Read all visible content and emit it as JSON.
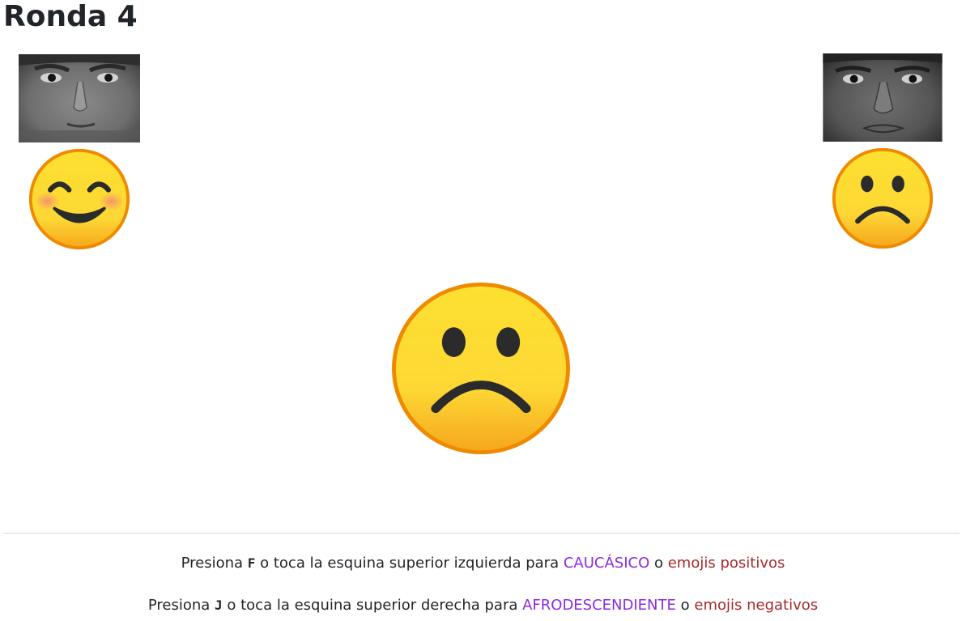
{
  "title": "Ronda 4",
  "left": {
    "face_icon": "caucasian-face-photo",
    "emoji_icon": "smiling-face-with-blush-emoji"
  },
  "right": {
    "face_icon": "afro-descendant-face-photo",
    "emoji_icon": "frowning-face-emoji"
  },
  "stimulus": {
    "icon": "frowning-face-emoji"
  },
  "instructions": {
    "line1": {
      "prefix": "Presiona ",
      "key": "F",
      "middle": " o toca la esquina superior izquierda para ",
      "category": "CAUCÁSICO",
      "joiner": " o ",
      "attribute": "emojis positivos"
    },
    "line2": {
      "prefix": "Presiona ",
      "key": "J",
      "middle": " o toca la esquina superior derecha para ",
      "category": "AFRODESCENDIENTE",
      "joiner": " o ",
      "attribute": "emojis negativos"
    }
  },
  "colors": {
    "category": "#8a2be2",
    "attribute": "#a52a2a",
    "emoji_yellow": "#fdd835",
    "emoji_orange": "#f59c12",
    "emoji_outline": "#ef8a00"
  }
}
